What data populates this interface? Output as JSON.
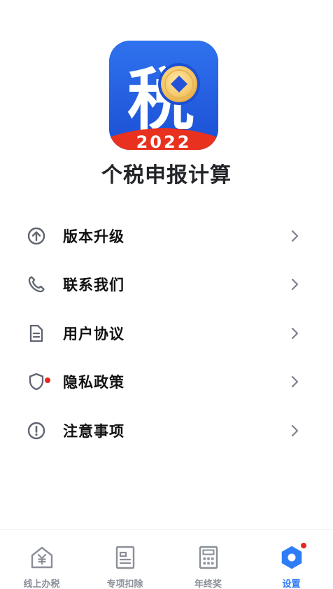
{
  "app": {
    "logo_char": "税",
    "logo_year": "2022",
    "name": "个税申报计算"
  },
  "menu": [
    {
      "label": "版本升级",
      "icon": "arrow-up-circle-icon",
      "badge": false
    },
    {
      "label": "联系我们",
      "icon": "phone-icon",
      "badge": false
    },
    {
      "label": "用户协议",
      "icon": "document-icon",
      "badge": false
    },
    {
      "label": "隐私政策",
      "icon": "shield-icon",
      "badge": true
    },
    {
      "label": "注意事项",
      "icon": "exclamation-circle-icon",
      "badge": false
    }
  ],
  "tabbar": [
    {
      "label": "线上办税",
      "icon": "yuan-house-icon",
      "active": false
    },
    {
      "label": "专项扣除",
      "icon": "form-icon",
      "active": false
    },
    {
      "label": "年终奖",
      "icon": "calculator-icon",
      "active": false
    },
    {
      "label": "设置",
      "icon": "settings-hexagon-icon",
      "active": true,
      "badge": true
    }
  ],
  "colors": {
    "accent": "#2f7df6",
    "logo_blue": "#1f52d6",
    "logo_red": "#e8321f",
    "badge_red": "#e8251f",
    "icon_gray": "#5f6470",
    "tab_gray": "#8a8f98"
  }
}
